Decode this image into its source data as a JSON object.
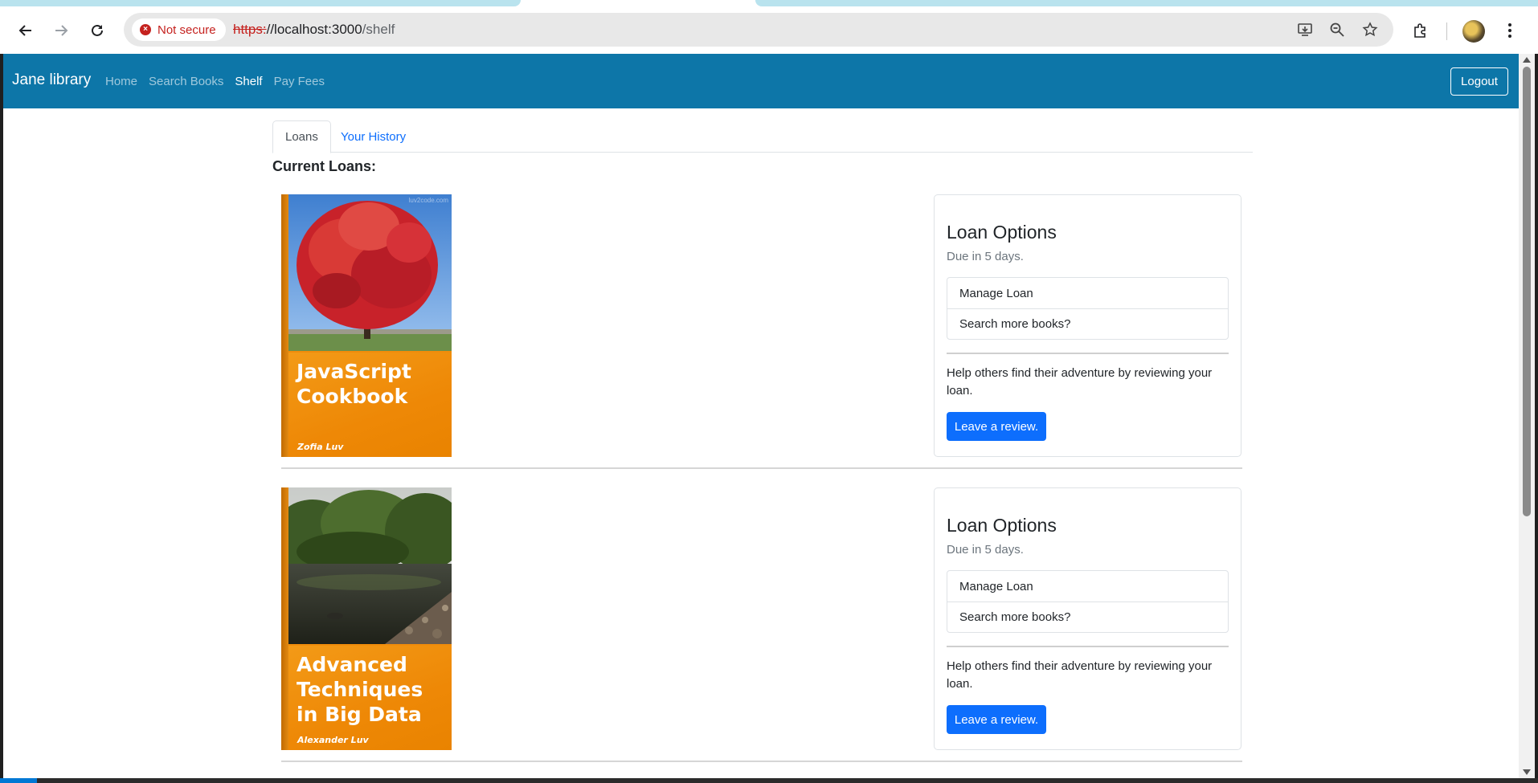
{
  "browser": {
    "security_label": "Not secure",
    "url_scheme": "https:",
    "url_host": "//localhost:3000",
    "url_path": "/shelf"
  },
  "navbar": {
    "brand": "Jane library",
    "links": [
      "Home",
      "Search Books",
      "Shelf",
      "Pay Fees"
    ],
    "active": "Shelf",
    "logout_label": "Logout",
    "color": "#0d76a8"
  },
  "tabs": {
    "loans": "Loans",
    "history": "Your History"
  },
  "section_title": "Current Loans:",
  "loans": [
    {
      "cover_title": "JavaScript Cookbook",
      "cover_author": "Zofia Luv",
      "cover_watermark": "luv2code.com",
      "card_title": "Loan Options",
      "due": "Due in 5 days.",
      "manage_label": "Manage Loan",
      "search_label": "Search more books?",
      "help_text": "Help others find their adventure by reviewing your loan.",
      "review_label": "Leave a review."
    },
    {
      "cover_title": "Advanced Techniques in Big Data",
      "cover_author": "Alexander Luv",
      "card_title": "Loan Options",
      "due": "Due in 5 days.",
      "manage_label": "Manage Loan",
      "search_label": "Search more books?",
      "help_text": "Help others find their adventure by reviewing your loan.",
      "review_label": "Leave a review."
    }
  ],
  "colors": {
    "primary_button": "#0d6efd",
    "cover_orange": "#f08c0a"
  }
}
